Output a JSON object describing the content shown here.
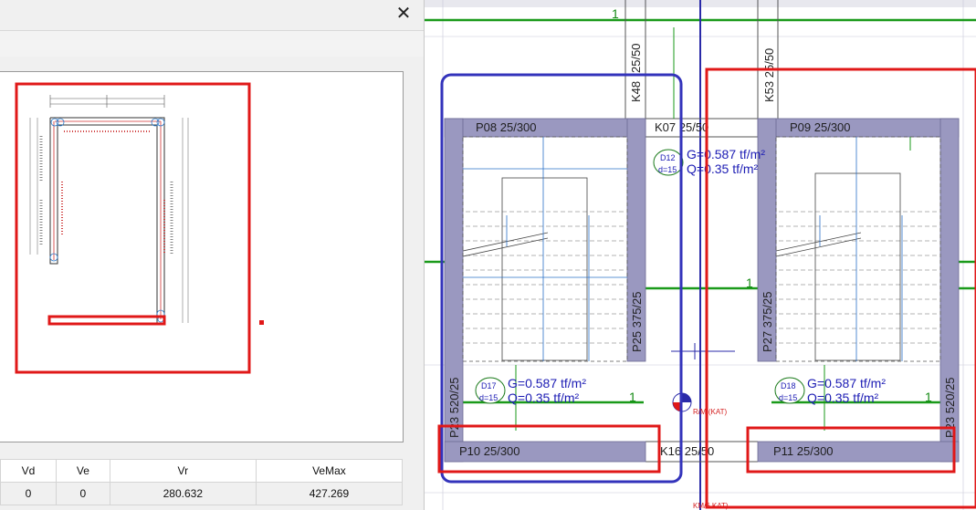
{
  "dialog": {
    "close_glyph": "✕"
  },
  "table": {
    "headers": [
      "Vd",
      "Ve",
      "Vr",
      "VeMax"
    ],
    "rows": [
      [
        "0",
        "0",
        "280.632",
        "427.269"
      ]
    ]
  },
  "drawing": {
    "labels": {
      "p08": "P08 25/300",
      "p09": "P09 25/300",
      "p10": "P10 25/300",
      "p11": "P11 25/300",
      "k07": "K07 25/50",
      "k16": "K16 25/50",
      "k48": "K48",
      "k48b": "25/50",
      "k53": "K53 25/50",
      "p25": "P25 375/25",
      "p27": "P27 375/25",
      "p23a": "P23 520/25",
      "p23b": "P23 520/25",
      "d12": "D12",
      "d12_d": "d=15",
      "d12_g": "G=0.587 tf/m²",
      "d12_q": "Q=0.35 tf/m²",
      "d17": "D17",
      "d17_d": "d=15",
      "d17_g": "G=0.587 tf/m²",
      "d17_q": "Q=0.35 tf/m²",
      "d18": "D18",
      "d18_d": "d=15",
      "d18_g": "G=0.587 tf/m²",
      "d18_q": "Q=0.35 tf/m²",
      "one": "1",
      "ref": "R/M (KAT)",
      "ref2": "KM/6 KAT)"
    }
  },
  "colors": {
    "wall": "#9a98c0",
    "grid_green": "#1a9a1a",
    "axis_blue": "#2a2aa8",
    "highlight_red": "#e01818",
    "highlight_blue": "#3333bb"
  }
}
